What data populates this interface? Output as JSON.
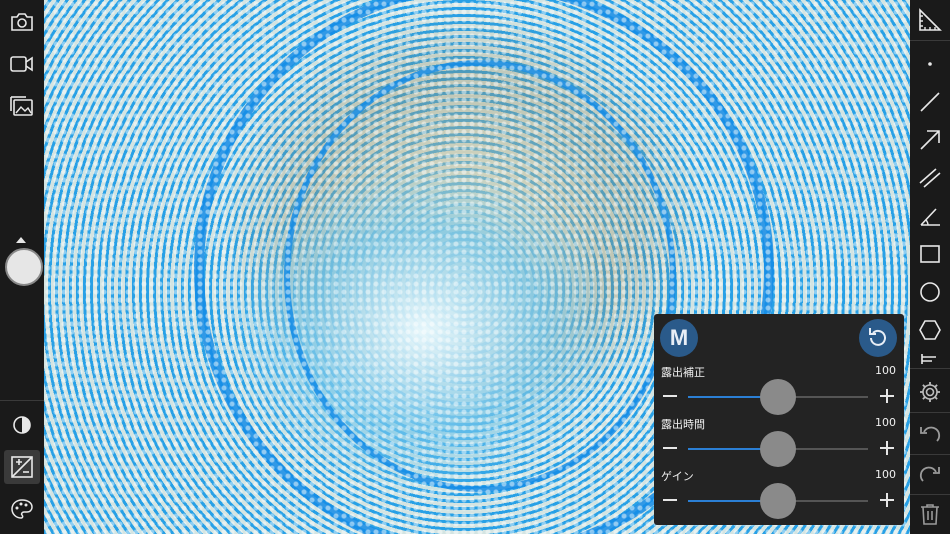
{
  "app": {
    "name": "microscope-camera"
  },
  "left_toolbar": {
    "items": [
      {
        "name": "camera-capture",
        "icon": "camera-icon"
      },
      {
        "name": "video-record",
        "icon": "video-icon"
      },
      {
        "name": "gallery",
        "icon": "gallery-icon"
      },
      {
        "name": "shutter",
        "icon": "shutter-icon"
      },
      {
        "name": "contrast",
        "icon": "contrast-icon"
      },
      {
        "name": "exposure",
        "icon": "exposure-icon",
        "active": true
      },
      {
        "name": "color",
        "icon": "palette-icon"
      }
    ]
  },
  "right_toolbar": {
    "items": [
      {
        "name": "measure",
        "icon": "ruler-icon"
      },
      {
        "name": "point",
        "icon": "point-icon"
      },
      {
        "name": "line",
        "icon": "line-icon"
      },
      {
        "name": "arrow",
        "icon": "arrow-icon"
      },
      {
        "name": "parallel",
        "icon": "parallel-lines-icon"
      },
      {
        "name": "angle",
        "icon": "angle-icon"
      },
      {
        "name": "rectangle",
        "icon": "rectangle-icon"
      },
      {
        "name": "circle",
        "icon": "circle-icon"
      },
      {
        "name": "polygon",
        "icon": "hexagon-icon"
      },
      {
        "name": "settings",
        "icon": "gear-icon"
      },
      {
        "name": "undo",
        "icon": "undo-icon"
      },
      {
        "name": "redo",
        "icon": "redo-icon"
      },
      {
        "name": "delete",
        "icon": "trash-icon"
      }
    ]
  },
  "exposure_panel": {
    "mode_label": "M",
    "sliders": [
      {
        "label": "露出補正",
        "value": "100",
        "level": 0.5
      },
      {
        "label": "露出時間",
        "value": "100",
        "level": 0.5
      },
      {
        "label": "ゲイン",
        "value": "100",
        "level": 0.5
      }
    ]
  },
  "colors": {
    "accent": "#2b7fd4",
    "panel_bg": "#232323",
    "toolbar_bg": "#1a1a1a"
  }
}
